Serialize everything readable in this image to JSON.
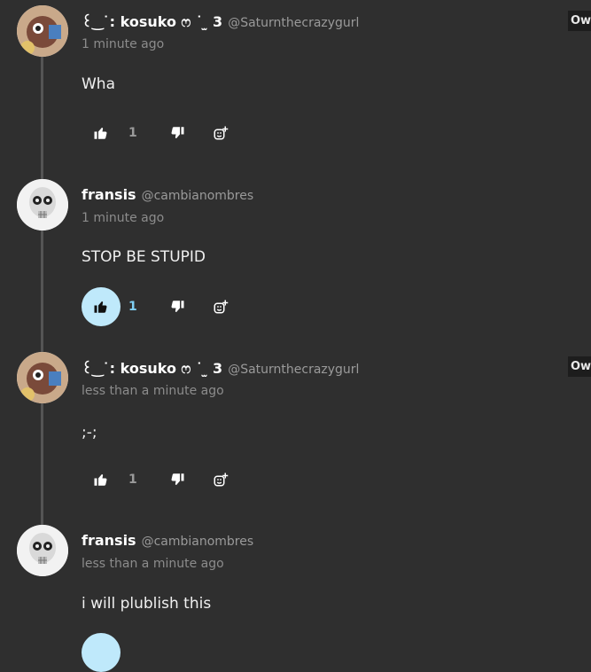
{
  "comments": [
    {
      "display_name": "꒰ ͜ ˙: kosuko ෆ ˙ ̫ 3",
      "handle": "@Saturnthecrazygurl",
      "timestamp": "1 minute ago",
      "text": "Wha",
      "like_count": "1",
      "liked": false,
      "badge": "Ow",
      "avatar_icon": "cartoon-avatar-icon"
    },
    {
      "display_name": "fransis",
      "handle": "@cambianombres",
      "timestamp": "1 minute ago",
      "text": "STOP BE STUPID",
      "like_count": "1",
      "liked": true,
      "avatar_icon": "skull-avatar-icon"
    },
    {
      "display_name": "꒰ ͜ ˙: kosuko ෆ ˙ ̫ 3",
      "handle": "@Saturnthecrazygurl",
      "timestamp": "less than a minute ago",
      "text": ";-;",
      "like_count": "1",
      "liked": false,
      "badge": "Ow",
      "avatar_icon": "cartoon-avatar-icon"
    },
    {
      "display_name": "fransis",
      "handle": "@cambianombres",
      "timestamp": "less than a minute ago",
      "text": "i will plublish this",
      "avatar_icon": "skull-avatar-icon"
    }
  ],
  "colors": {
    "background": "#2f2f2f",
    "like_active_bg": "#bfe9fb",
    "like_active_count": "#7fd0f5",
    "handle": "#9a9a9a"
  }
}
